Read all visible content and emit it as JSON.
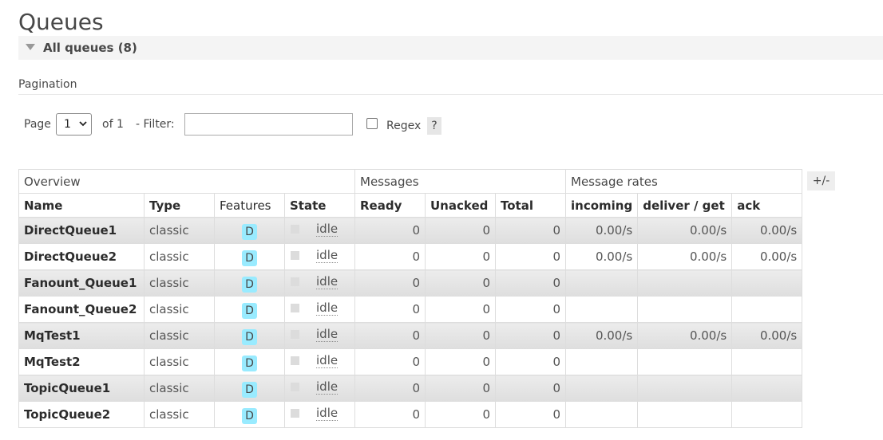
{
  "page": {
    "title": "Queues"
  },
  "section": {
    "title": "All queues (8)"
  },
  "pagination": {
    "label": "Pagination",
    "page_label": "Page",
    "page_value": "1",
    "of_label": "of 1",
    "filter_label": "- Filter:",
    "filter_value": "",
    "regex_label": "Regex",
    "help_label": "?"
  },
  "columns_toggle": "+/-",
  "table": {
    "groups": {
      "overview": "Overview",
      "messages": "Messages",
      "rates": "Message rates"
    },
    "headers": {
      "name": "Name",
      "type": "Type",
      "features": "Features",
      "state": "State",
      "ready": "Ready",
      "unacked": "Unacked",
      "total": "Total",
      "incoming": "incoming",
      "deliver": "deliver / get",
      "ack": "ack"
    },
    "rows": [
      {
        "name": "DirectQueue1",
        "type": "classic",
        "feature": "D",
        "state": "idle",
        "ready": "0",
        "unacked": "0",
        "total": "0",
        "incoming": "0.00/s",
        "deliver": "0.00/s",
        "ack": "0.00/s"
      },
      {
        "name": "DirectQueue2",
        "type": "classic",
        "feature": "D",
        "state": "idle",
        "ready": "0",
        "unacked": "0",
        "total": "0",
        "incoming": "0.00/s",
        "deliver": "0.00/s",
        "ack": "0.00/s"
      },
      {
        "name": "Fanount_Queue1",
        "type": "classic",
        "feature": "D",
        "state": "idle",
        "ready": "0",
        "unacked": "0",
        "total": "0",
        "incoming": "",
        "deliver": "",
        "ack": ""
      },
      {
        "name": "Fanount_Queue2",
        "type": "classic",
        "feature": "D",
        "state": "idle",
        "ready": "0",
        "unacked": "0",
        "total": "0",
        "incoming": "",
        "deliver": "",
        "ack": ""
      },
      {
        "name": "MqTest1",
        "type": "classic",
        "feature": "D",
        "state": "idle",
        "ready": "0",
        "unacked": "0",
        "total": "0",
        "incoming": "0.00/s",
        "deliver": "0.00/s",
        "ack": "0.00/s"
      },
      {
        "name": "MqTest2",
        "type": "classic",
        "feature": "D",
        "state": "idle",
        "ready": "0",
        "unacked": "0",
        "total": "0",
        "incoming": "",
        "deliver": "",
        "ack": ""
      },
      {
        "name": "TopicQueue1",
        "type": "classic",
        "feature": "D",
        "state": "idle",
        "ready": "0",
        "unacked": "0",
        "total": "0",
        "incoming": "",
        "deliver": "",
        "ack": ""
      },
      {
        "name": "TopicQueue2",
        "type": "classic",
        "feature": "D",
        "state": "idle",
        "ready": "0",
        "unacked": "0",
        "total": "0",
        "incoming": "",
        "deliver": "",
        "ack": ""
      }
    ]
  }
}
